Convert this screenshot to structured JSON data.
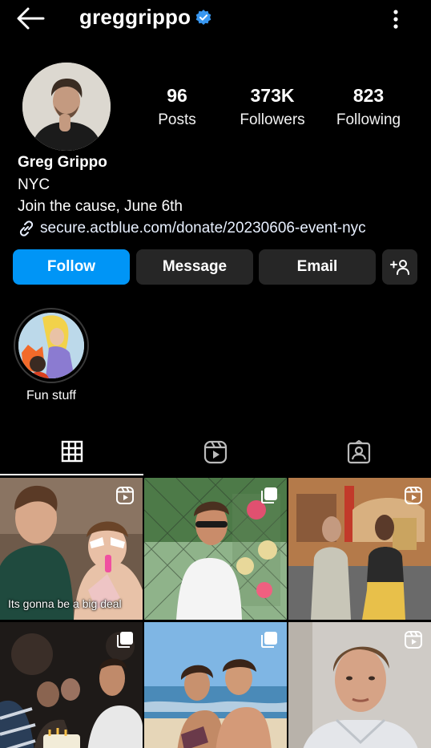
{
  "header": {
    "username": "greggrippo",
    "back_icon": "arrow-left-icon",
    "verified_icon": "verified-badge-icon",
    "more_icon": "more-vertical-icon"
  },
  "stats": {
    "posts": {
      "value": "96",
      "label": "Posts"
    },
    "followers": {
      "value": "373K",
      "label": "Followers"
    },
    "following": {
      "value": "823",
      "label": "Following"
    }
  },
  "bio": {
    "name": "Greg Grippo",
    "location": "NYC",
    "tagline": "Join the cause, June 6th",
    "link": "secure.actblue.com/donate/20230606-event-nyc",
    "link_icon": "link-icon"
  },
  "actions": {
    "follow": "Follow",
    "message": "Message",
    "email": "Email",
    "add_user_icon": "add-person-icon"
  },
  "highlights": [
    {
      "label": "Fun stuff"
    }
  ],
  "tabs": [
    {
      "icon": "grid-icon",
      "active": true
    },
    {
      "icon": "reels-icon",
      "active": false
    },
    {
      "icon": "tagged-icon",
      "active": false
    }
  ],
  "posts": [
    {
      "type": "reel",
      "caption": "Its gonna be a big deal"
    },
    {
      "type": "carousel",
      "caption": ""
    },
    {
      "type": "reel",
      "caption": ""
    },
    {
      "type": "carousel",
      "caption": ""
    },
    {
      "type": "carousel",
      "caption": ""
    },
    {
      "type": "reel",
      "caption": ""
    }
  ],
  "colors": {
    "background": "#000000",
    "accent": "#0095f6",
    "secondary_button": "#262626",
    "verified": "#3897f0"
  }
}
